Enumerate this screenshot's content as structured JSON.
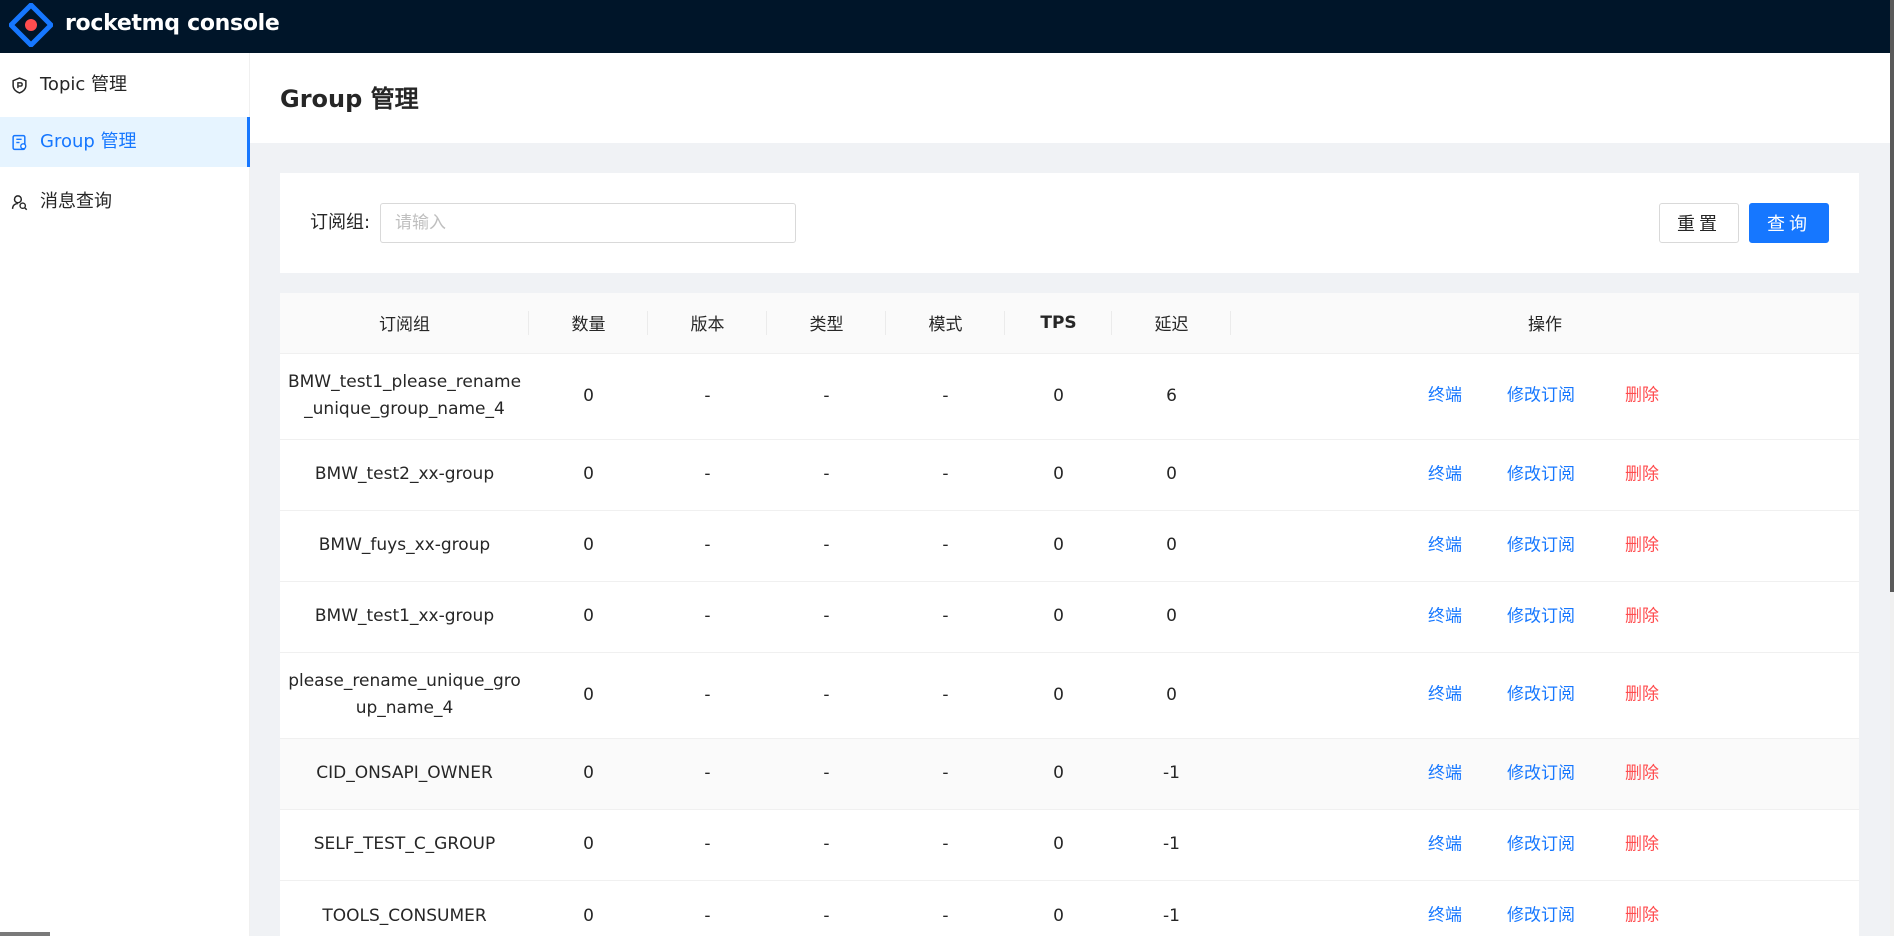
{
  "app": {
    "title": "rocketmq console"
  },
  "sidebar": {
    "items": [
      {
        "label": "Topic 管理",
        "icon": "shield-icon",
        "active": false
      },
      {
        "label": "Group 管理",
        "icon": "group-icon",
        "active": true
      },
      {
        "label": "消息查询",
        "icon": "user-search-icon",
        "active": false
      }
    ]
  },
  "page": {
    "title": "Group 管理"
  },
  "search": {
    "label": "订阅组:",
    "placeholder": "请输入",
    "value": "",
    "reset_label": "重置",
    "query_label": "查询"
  },
  "table": {
    "columns": [
      "订阅组",
      "数量",
      "版本",
      "类型",
      "模式",
      "TPS",
      "延迟",
      "操作"
    ],
    "rows": [
      {
        "group": "BMW_test1_please_rename_unique_group_name_4",
        "count": "0",
        "version": "-",
        "type": "-",
        "mode": "-",
        "tps": "0",
        "delay": "6"
      },
      {
        "group": "BMW_test2_xx-group",
        "count": "0",
        "version": "-",
        "type": "-",
        "mode": "-",
        "tps": "0",
        "delay": "0"
      },
      {
        "group": "BMW_fuys_xx-group",
        "count": "0",
        "version": "-",
        "type": "-",
        "mode": "-",
        "tps": "0",
        "delay": "0"
      },
      {
        "group": "BMW_test1_xx-group",
        "count": "0",
        "version": "-",
        "type": "-",
        "mode": "-",
        "tps": "0",
        "delay": "0"
      },
      {
        "group": "please_rename_unique_group_name_4",
        "count": "0",
        "version": "-",
        "type": "-",
        "mode": "-",
        "tps": "0",
        "delay": "0"
      },
      {
        "group": "CID_ONSAPI_OWNER",
        "count": "0",
        "version": "-",
        "type": "-",
        "mode": "-",
        "tps": "0",
        "delay": "-1"
      },
      {
        "group": "SELF_TEST_C_GROUP",
        "count": "0",
        "version": "-",
        "type": "-",
        "mode": "-",
        "tps": "0",
        "delay": "-1"
      },
      {
        "group": "TOOLS_CONSUMER",
        "count": "0",
        "version": "-",
        "type": "-",
        "mode": "-",
        "tps": "0",
        "delay": "-1"
      }
    ],
    "actions": {
      "client": "终端",
      "modify": "修改订阅",
      "delete": "删除"
    }
  },
  "colors": {
    "header_bg": "#001529",
    "primary": "#1677ff",
    "danger": "#ff4d4f",
    "content_bg": "#f0f2f5"
  }
}
